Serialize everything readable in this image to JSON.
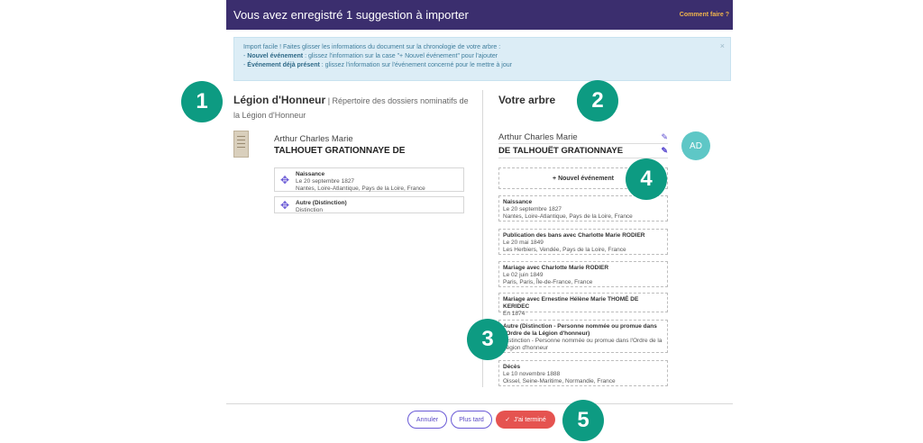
{
  "header": {
    "title": "Vous avez enregistré 1 suggestion à importer",
    "help_link": "Comment faire ?"
  },
  "info": {
    "line1": "Import facile ! Faites glisser les informations du document sur la chronologie de votre arbre :",
    "line2_label": "Nouvel événement",
    "line2_text": " : glissez l'information sur la case \"+ Nouvel événement\" pour l'ajouter",
    "line3_label": "Événement déjà présent",
    "line3_text": " : glissez l'information sur l'événement concerné pour le mettre à jour",
    "close_icon": "×"
  },
  "source": {
    "title_strong": "Légion d'Honneur",
    "title_sep": " | ",
    "title_sub": "Répertoire des dossiers nominatifs de la Légion d'Honneur",
    "first_names": "Arthur Charles Marie",
    "last_name": "TALHOUET GRATIONNAYE DE",
    "events": [
      {
        "title": "Naissance",
        "line1": "Le 20 septembre 1827",
        "line2": "Nantes, Loire-Atlantique, Pays de la Loire, France"
      },
      {
        "title": "Autre (Distinction)",
        "line1": "Distinction",
        "line2": ""
      }
    ]
  },
  "tree": {
    "title": "Votre arbre",
    "first_names": "Arthur Charles Marie",
    "last_name": "DE TALHOUËT GRATIONNAYE",
    "avatar_initials": "AD",
    "new_event_label": "+ Nouvel événement",
    "events": [
      {
        "title": "Naissance",
        "line1": "Le 20 septembre 1827",
        "line2": "Nantes, Loire-Atlantique, Pays de la Loire, France"
      },
      {
        "title": "Publication des bans avec Charlotte Marie RODIER",
        "line1": "Le 20 mai 1849",
        "line2": "Les Herbiers, Vendée, Pays de la Loire, France"
      },
      {
        "title": "Mariage avec Charlotte Marie RODIER",
        "line1": "Le 02 juin 1849",
        "line2": "Paris, Paris, Île-de-France, France"
      },
      {
        "title": "Mariage avec Ernestine Hélène Marie THOMÉ DE KERIDEC",
        "line1": "En 1874",
        "line2": ""
      },
      {
        "title": "Autre (Distinction - Personne nommée ou promue dans l'Ordre de la Légion d'honneur)",
        "line1": "Distinction - Personne nommée ou promue dans l'Ordre de la Légion d'honneur",
        "line2": ""
      },
      {
        "title": "Décès",
        "line1": "Le 10 novembre 1888",
        "line2": "Oissel, Seine-Maritime, Normandie, France"
      }
    ]
  },
  "footer": {
    "cancel_label": "Annuler",
    "later_label": "Plus tard",
    "done_label": "J'ai terminé"
  },
  "badges": [
    "1",
    "2",
    "3",
    "4",
    "5"
  ],
  "colors": {
    "header_bg": "#3b2e6e",
    "help_link": "#f0b44c",
    "info_bg": "#dcedf6",
    "accent": "#6a5ad6",
    "done": "#e55350",
    "badge": "#0d9b82",
    "avatar": "#5ec7c6"
  }
}
